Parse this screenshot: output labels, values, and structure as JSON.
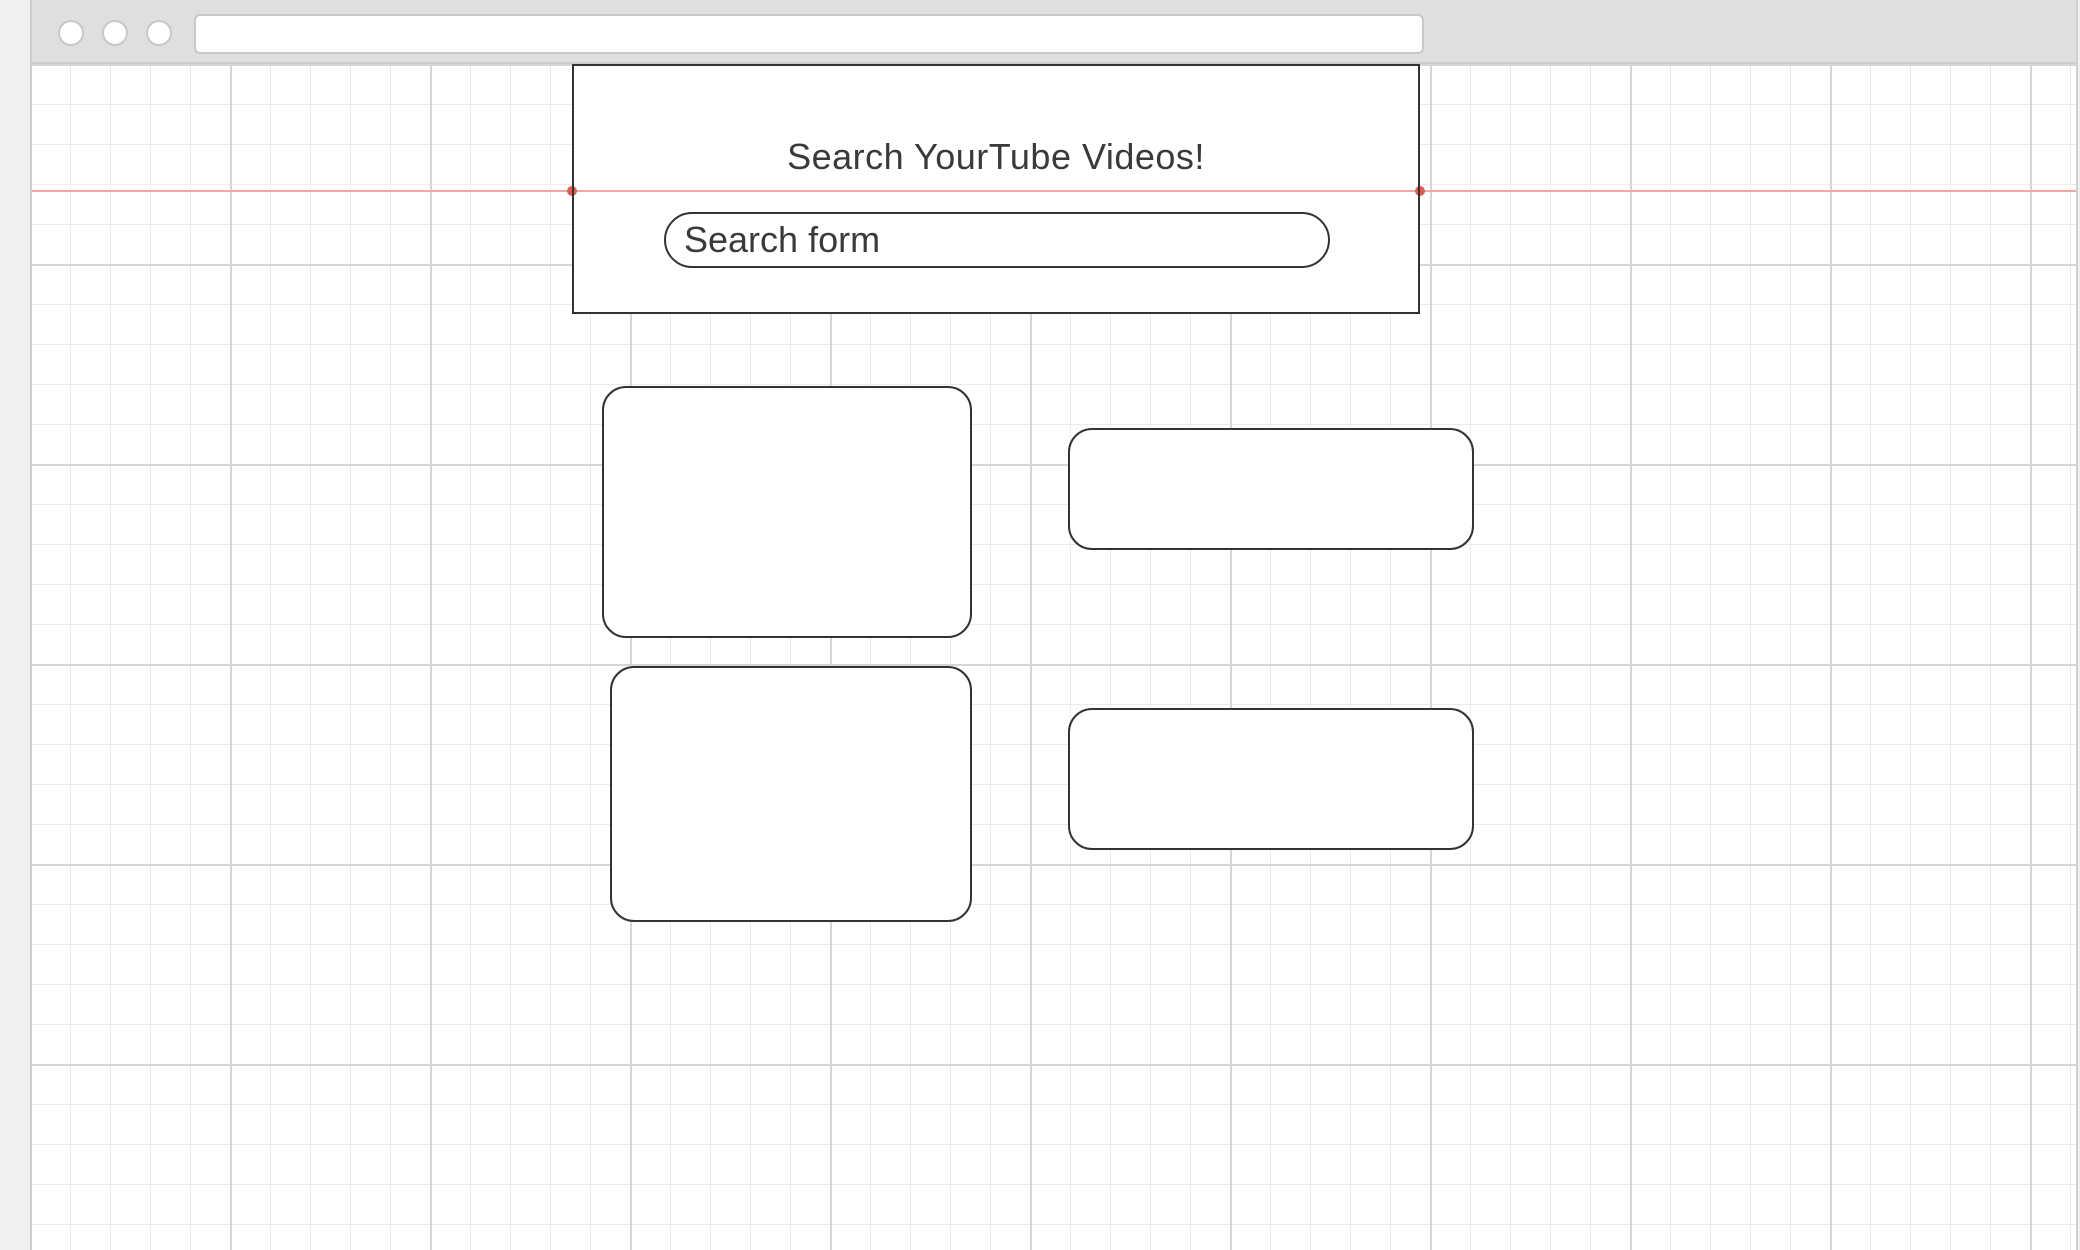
{
  "header": {
    "title": "Search YourTube Videos!"
  },
  "search": {
    "placeholder": "Search form",
    "value": ""
  },
  "results": [
    {
      "thumbnail": "",
      "info": ""
    },
    {
      "thumbnail": "",
      "info": ""
    }
  ],
  "colors": {
    "stroke": "#333333",
    "guide": "#e06050",
    "grid": "#d6d6d6",
    "titlebar": "#dfdfdf"
  }
}
